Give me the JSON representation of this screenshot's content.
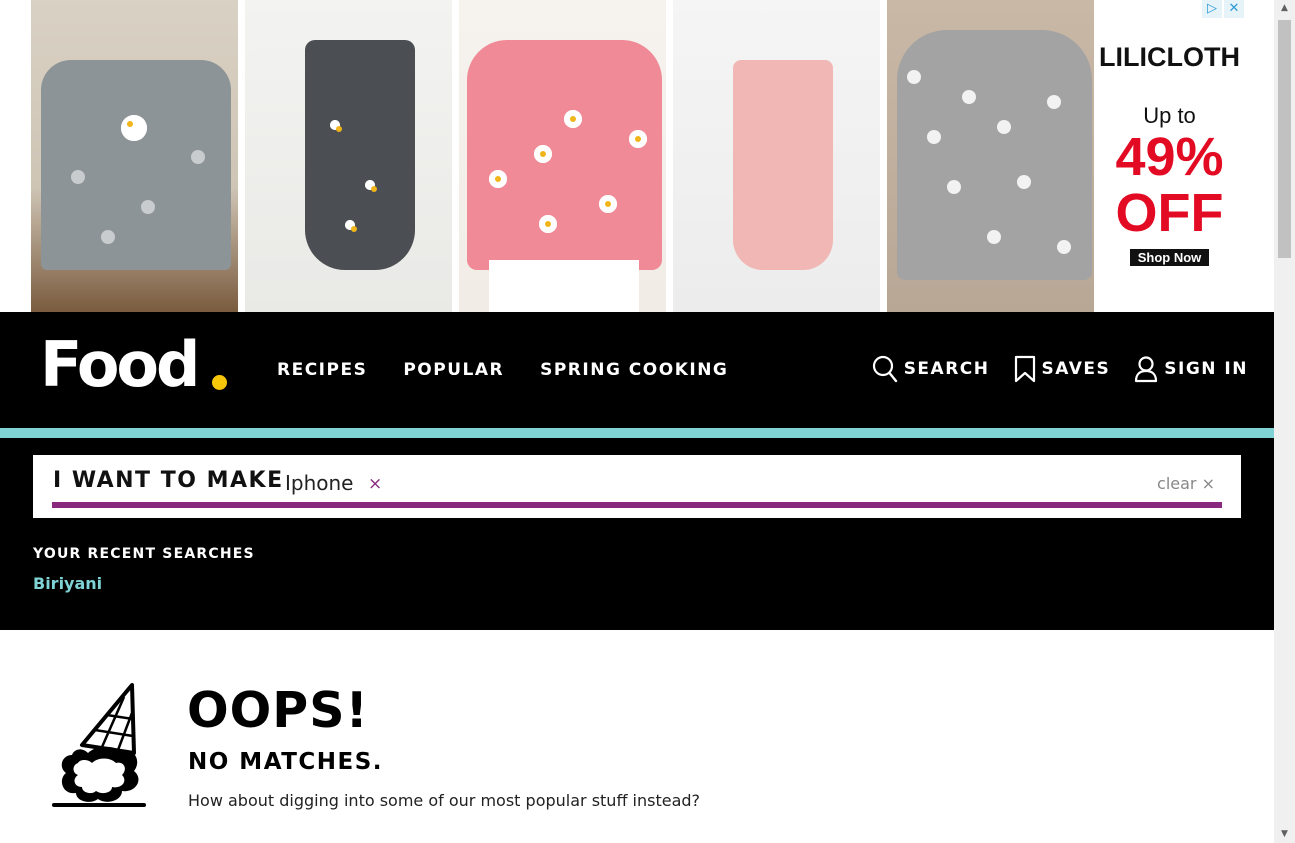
{
  "ad": {
    "brand": "LILICLOTH",
    "up_to": "Up to",
    "percent": "49%",
    "off": "OFF",
    "cta": "Shop Now",
    "choices_icon": "ad-choices-icon",
    "close_icon": "close-icon"
  },
  "header": {
    "logo": "Food",
    "nav": [
      "RECIPES",
      "POPULAR",
      "SPRING COOKING"
    ],
    "search_label": "SEARCH",
    "saves_label": "SAVES",
    "signin_label": "SIGN IN"
  },
  "search": {
    "label": "I WANT TO MAKE",
    "term": "Iphone",
    "term_remove": "×",
    "clear_label": "clear",
    "clear_icon": "×"
  },
  "recent": {
    "label": "YOUR RECENT SEARCHES",
    "items": [
      "Biriyani"
    ]
  },
  "no_results": {
    "title": "OOPS!",
    "subtitle": "NO MATCHES.",
    "message": "How about digging into some of our most popular stuff instead?"
  },
  "colors": {
    "accent_teal": "#7fd3d5",
    "accent_purple": "#8a2a7e",
    "logo_dot": "#f5c60a",
    "sale_red": "#e30b23"
  }
}
